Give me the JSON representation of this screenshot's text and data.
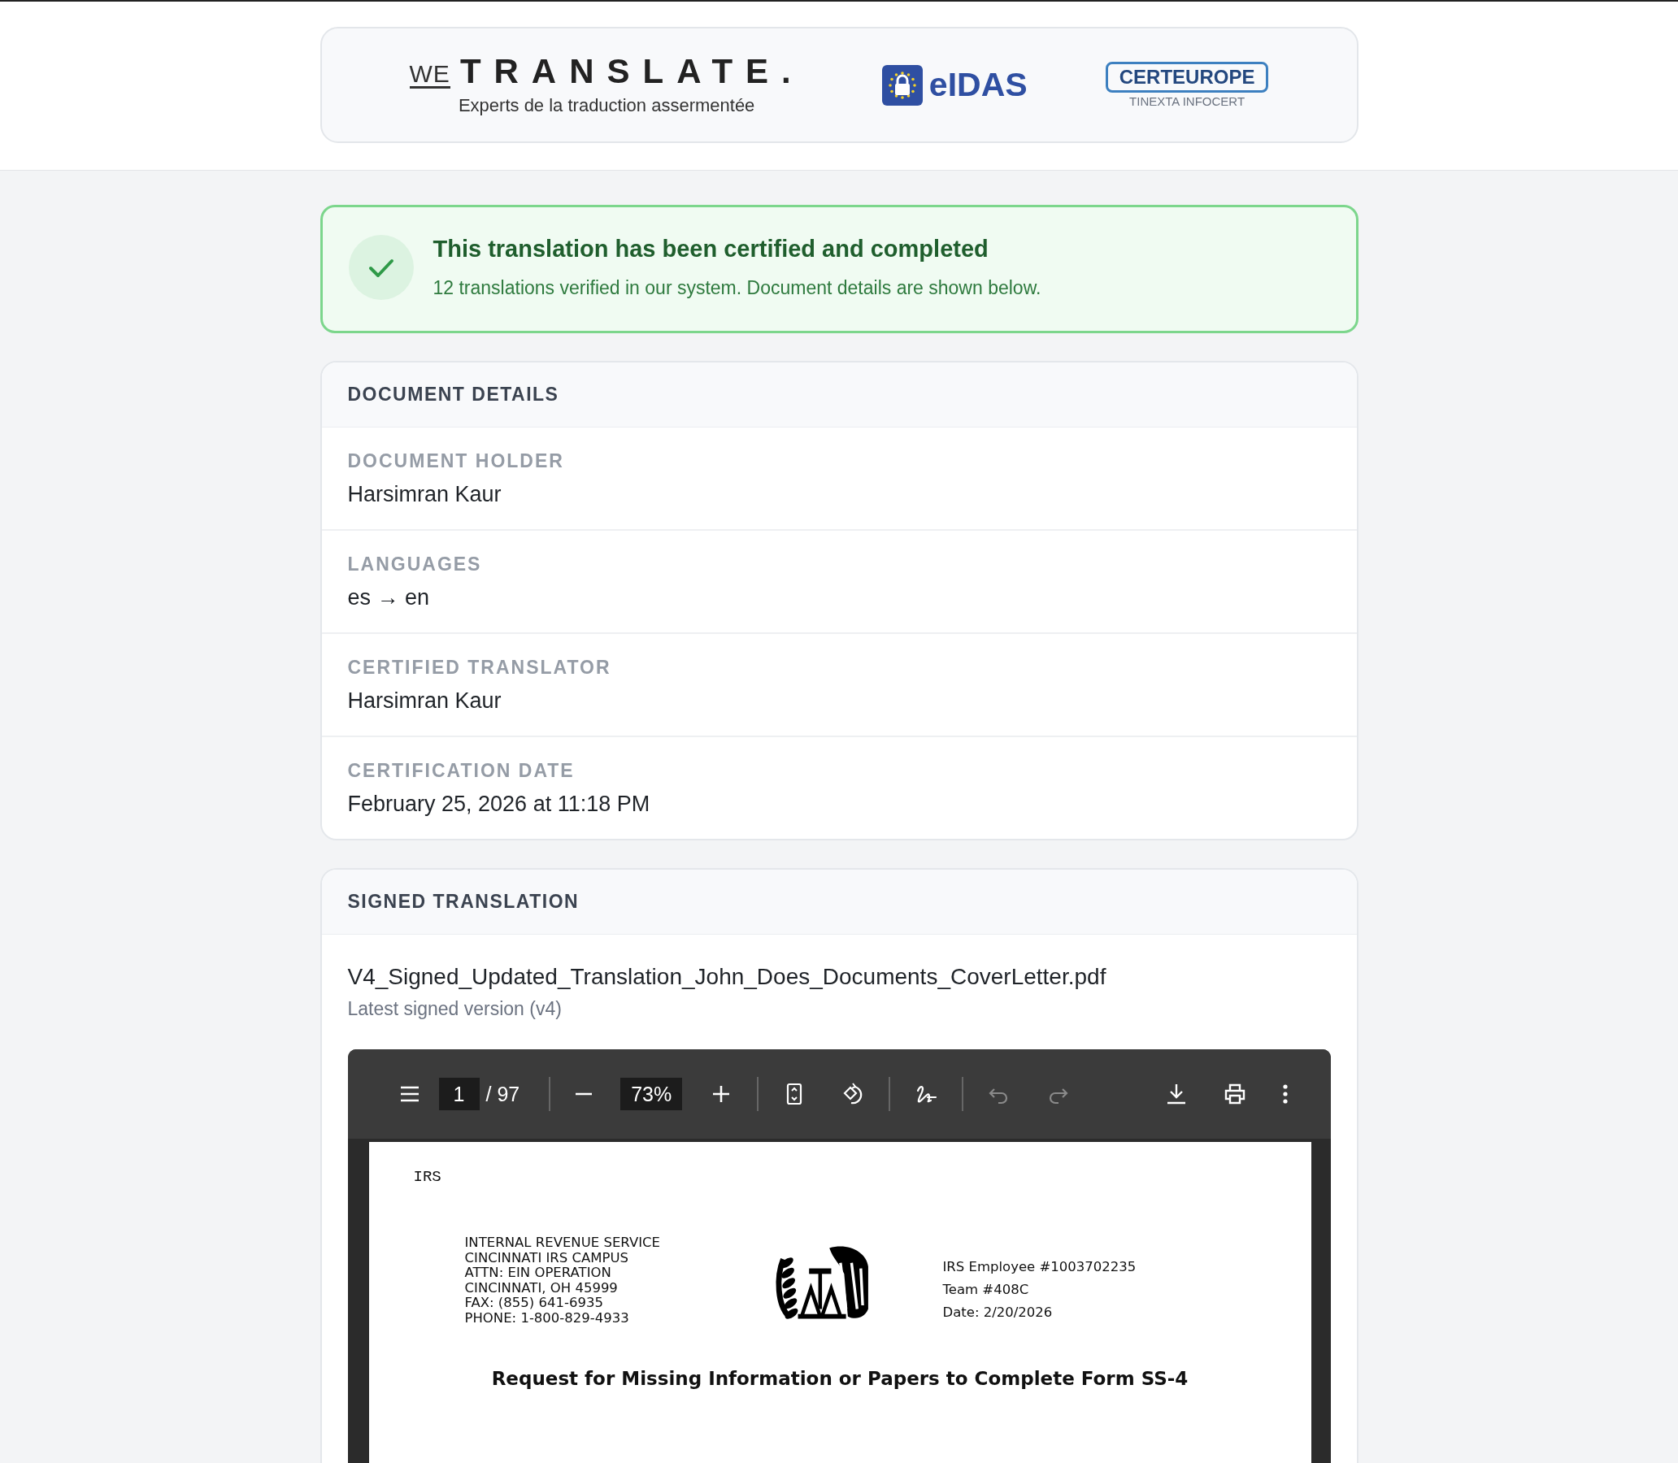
{
  "header": {
    "logos": [
      {
        "kind": "wetranslate",
        "mark": "WE",
        "name": "TRANSLATE.",
        "tagline": "Experts de la traduction assermentée"
      },
      {
        "kind": "eidas",
        "name": "eIDAS"
      },
      {
        "kind": "certeurope",
        "name": "CERTEUROPE",
        "tagline": "TINEXTA INFOCERT"
      }
    ]
  },
  "banner": {
    "title": "This translation has been certified and completed",
    "message": "12 translations verified in our system. Document details are shown below."
  },
  "document_details": {
    "title": "DOCUMENT DETAILS",
    "fields": [
      {
        "label": "DOCUMENT HOLDER",
        "value": "Harsimran Kaur"
      },
      {
        "label": "LANGUAGES",
        "value": "es → en"
      },
      {
        "label": "CERTIFIED TRANSLATOR",
        "value": "Harsimran Kaur"
      },
      {
        "label": "CERTIFICATION DATE",
        "value": "February 25, 2026 at 11:18 PM"
      }
    ]
  },
  "signed_translation": {
    "title": "SIGNED TRANSLATION",
    "file_name": "V4_Signed_Updated_Translation_John_Does_Documents_CoverLetter.pdf",
    "version_note": "Latest signed version (v4)",
    "viewer": {
      "page": "1",
      "page_count": "/ 97",
      "zoom": "73%",
      "tools": [
        {
          "kind": "menu",
          "disabled": false
        },
        {
          "kind": "page"
        },
        {
          "kind": "divider"
        },
        {
          "kind": "zoom_out",
          "disabled": false
        },
        {
          "kind": "zoom"
        },
        {
          "kind": "zoom_in",
          "disabled": false
        },
        {
          "kind": "divider"
        },
        {
          "kind": "fit",
          "disabled": false
        },
        {
          "kind": "rotate",
          "disabled": false
        },
        {
          "kind": "divider"
        },
        {
          "kind": "draw",
          "disabled": false
        },
        {
          "kind": "divider"
        },
        {
          "kind": "undo",
          "disabled": true
        },
        {
          "kind": "redo",
          "disabled": true
        },
        {
          "kind": "spacer"
        },
        {
          "kind": "download",
          "disabled": false
        },
        {
          "kind": "print",
          "disabled": false
        },
        {
          "kind": "more",
          "disabled": false
        }
      ]
    },
    "document_page": {
      "letterhead": "IRS",
      "address_lines": [
        "INTERNAL REVENUE SERVICE",
        "CINCINNATI IRS CAMPUS",
        "ATTN: EIN OPERATION",
        "CINCINNATI, OH 45999",
        "FAX:  (855) 641-6935",
        "PHONE:  1-800-829-4933"
      ],
      "reference_lines": [
        "IRS Employee #1003702235",
        "Team #408C",
        "Date: 2/20/2026"
      ],
      "heading": "Request for Missing Information or Papers to Complete Form SS-4"
    }
  }
}
